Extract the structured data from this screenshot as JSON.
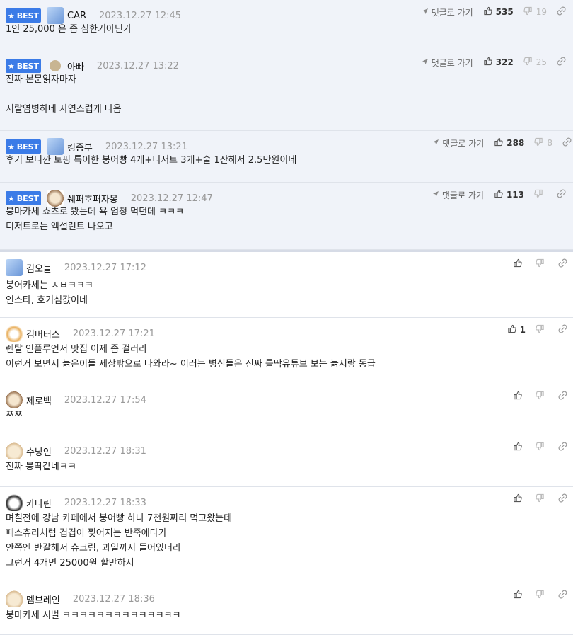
{
  "labels": {
    "best": "BEST",
    "reply": "댓글로 가기"
  },
  "colors": {
    "accent": "#3b7be7",
    "best_bg": "#f0f3f9"
  },
  "comments": [
    {
      "best": true,
      "avatar": "avatar-blue-icon",
      "nick": "CAR",
      "date": "2023.12.27 12:45",
      "likes": "535",
      "dislikes": "19",
      "lines": [
        "1인 25,000 은 좀 심한거아닌가"
      ]
    },
    {
      "best": true,
      "avatar": "avatar-dot-icon",
      "nick": "아빠",
      "date": "2023.12.27 13:22",
      "likes": "322",
      "dislikes": "25",
      "lines": [
        "진짜 본문읽자마자",
        "",
        "지랄염병하네 자연스럽게 나옴"
      ]
    },
    {
      "best": true,
      "avatar": "avatar-blue-icon",
      "nick": "킹종부",
      "date": "2023.12.27 13:21",
      "likes": "288",
      "dislikes": "8",
      "lines": [
        "후기 보니깐 토핑 특이한 붕어빵 4개+디저트 3개+술 1잔해서 2.5만원이네"
      ]
    },
    {
      "best": true,
      "avatar": "avatar-dog-icon",
      "nick": "쉐퍼호퍼자몽",
      "date": "2023.12.27 12:47",
      "likes": "113",
      "dislikes": "",
      "lines": [
        "붕마카세 쇼츠로 봤는데 욕 엄청 먹던데 ㅋㅋㅋ",
        "디저트로는 엑설런트 나오고"
      ]
    },
    {
      "best": false,
      "avatar": "avatar-blue-icon",
      "nick": "김오늘",
      "date": "2023.12.27 17:12",
      "likes": "",
      "dislikes": "",
      "lines": [
        "붕어카세는 ㅅㅂㅋㅋㅋ",
        "인스타, 호기심값이네"
      ]
    },
    {
      "best": false,
      "avatar": "avatar-fox-icon",
      "nick": "김버터스",
      "date": "2023.12.27 17:21",
      "likes": "1",
      "dislikes": "",
      "lines": [
        "렌탈 인플루언서 맛집 이제 좀 걸러라",
        "이런거 보면서 늙은이들 세상밖으로 나와라~ 이러는 병신들은 진짜 틀딱유튜브 보는 늙지랑 동급"
      ]
    },
    {
      "best": false,
      "avatar": "avatar-dog-icon",
      "nick": "제로백",
      "date": "2023.12.27 17:54",
      "likes": "",
      "dislikes": "",
      "lines": [
        "ㅉㅉ"
      ]
    },
    {
      "best": false,
      "avatar": "avatar-cream-icon",
      "nick": "수낭인",
      "date": "2023.12.27 18:31",
      "likes": "",
      "dislikes": "",
      "lines": [
        "진짜 붕딱같네ㅋㅋ"
      ]
    },
    {
      "best": false,
      "avatar": "avatar-black-icon",
      "nick": "카나린",
      "date": "2023.12.27 18:33",
      "likes": "",
      "dislikes": "",
      "lines": [
        "며칠전에 강남 카페에서 붕어빵 하나 7천원짜리 먹고왔는데",
        "패스츄리처럼 겹겹이 찢어지는 반죽에다가",
        "안쪽엔 반갈해서 슈크림, 과일까지 들어있더라",
        "그런거 4개면 25000원 할만하지"
      ]
    },
    {
      "best": false,
      "avatar": "avatar-cream-icon",
      "nick": "멤브레인",
      "date": "2023.12.27 18:36",
      "likes": "",
      "dislikes": "",
      "lines": [
        "붕마카세 시벌 ㅋㅋㅋㅋㅋㅋㅋㅋㅋㅋㅋㅋㅋㅋ"
      ]
    }
  ]
}
